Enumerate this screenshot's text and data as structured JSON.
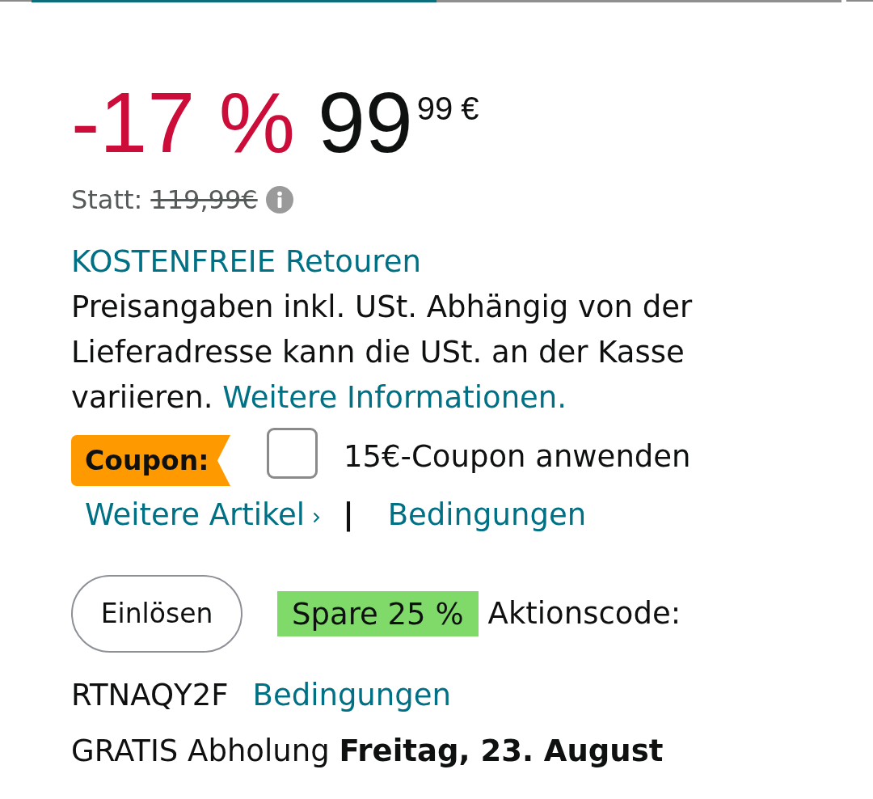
{
  "gallery_indicator": {
    "level": 0.5
  },
  "price": {
    "discount": "-17 %",
    "whole": "99",
    "fraction": "99",
    "currency": "€"
  },
  "list_price": {
    "label": "Statt:",
    "value": "119,99€"
  },
  "returns_link": "KOSTENFREIE Retouren",
  "tax_note": {
    "text": "Preisangaben inkl. USt. Abhängig von der Lieferadresse kann die USt. an der Kasse variieren.",
    "link": "Weitere Informationen."
  },
  "coupon": {
    "badge": "Coupon:",
    "checked": false,
    "label": "15€-Coupon anwenden",
    "more_link": "Weitere Artikel",
    "separator": "|",
    "terms_link": "Bedingungen"
  },
  "promo": {
    "button": "Einlösen",
    "badge": "Spare 25 %",
    "label": "Aktionscode:",
    "code": "RTNAQY2F",
    "terms_link": "Bedingungen"
  },
  "delivery": "GRATIS Abholung **Freitag, 23. August**"
}
